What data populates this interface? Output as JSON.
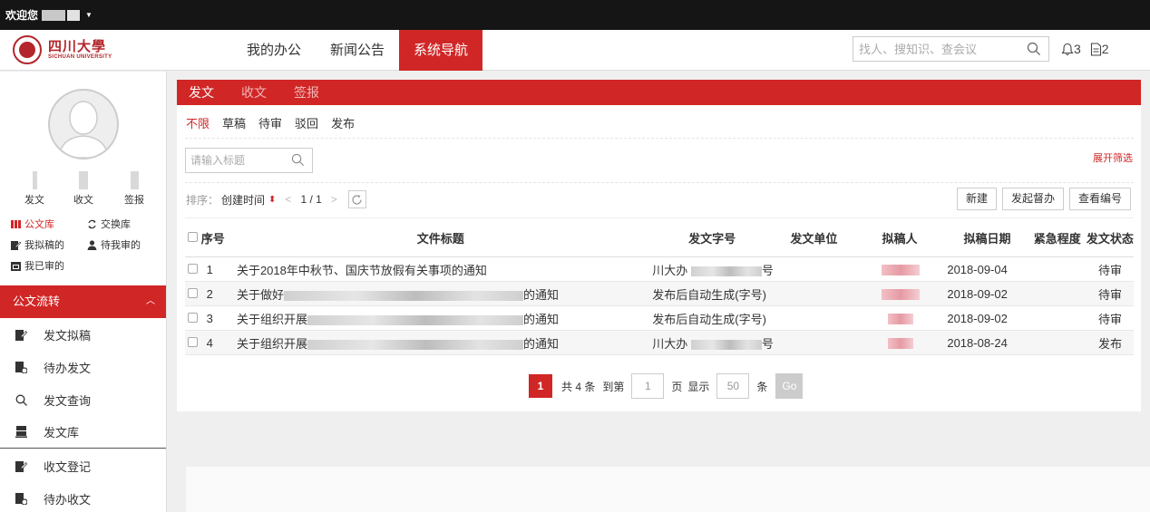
{
  "topbar": {
    "welcome": "欢迎您",
    "caret": "▼"
  },
  "header": {
    "logo_cn": "四川大學",
    "logo_en": "SICHUAN UNIVERSITY",
    "nav": [
      {
        "label": "我的办公",
        "active": false
      },
      {
        "label": "新闻公告",
        "active": false
      },
      {
        "label": "系统导航",
        "active": true
      }
    ],
    "search_placeholder": "找人、搜知识、查会议",
    "bell_count": "3",
    "doc_count": "2"
  },
  "sidebar": {
    "stats": [
      "发文",
      "收文",
      "签报"
    ],
    "quick": [
      "公文库",
      "交换库",
      "我拟稿的",
      "待我审的",
      "我已审的"
    ],
    "menu_head": "公文流转",
    "menu": [
      "发文拟稿",
      "待办发文",
      "发文查询",
      "发文库",
      "收文登记",
      "待办收文"
    ]
  },
  "panel": {
    "tabs": [
      {
        "label": "发文",
        "active": true
      },
      {
        "label": "收文",
        "active": false
      },
      {
        "label": "签报",
        "active": false
      }
    ],
    "filters": [
      {
        "label": "不限",
        "active": true
      },
      {
        "label": "草稿",
        "active": false
      },
      {
        "label": "待审",
        "active": false
      },
      {
        "label": "驳回",
        "active": false
      },
      {
        "label": "发布",
        "active": false
      }
    ],
    "title_placeholder": "请输入标题",
    "expand": "展开筛选",
    "sort_label": "排序：",
    "sort_value": "创建时间",
    "page_info": "1 / 1",
    "actions": [
      "新建",
      "发起督办",
      "查看编号"
    ],
    "columns": {
      "no": "序号",
      "title": "文件标题",
      "code": "发文字号",
      "unit": "发文单位",
      "author": "拟稿人",
      "date": "拟稿日期",
      "urgency": "紧急程度",
      "status": "发文状态"
    },
    "rows": [
      {
        "no": "1",
        "title": "关于2018年中秋节、国庆节放假有关事项的通知",
        "title_pre": "",
        "title_post": "",
        "code_pre": "川大办",
        "code_post": "号",
        "code_full": "",
        "date": "2018-09-04",
        "status": "待审"
      },
      {
        "no": "2",
        "title": "",
        "title_pre": "关于做好",
        "title_post": "的通知",
        "code_pre": "",
        "code_post": "",
        "code_full": "发布后自动生成(字号)",
        "date": "2018-09-02",
        "status": "待审"
      },
      {
        "no": "3",
        "title": "",
        "title_pre": "关于组织开展",
        "title_post": "的通知",
        "code_pre": "",
        "code_post": "",
        "code_full": "发布后自动生成(字号)",
        "date": "2018-09-02",
        "status": "待审"
      },
      {
        "no": "4",
        "title": "",
        "title_pre": "关于组织开展",
        "title_post": "的通知",
        "code_pre": "川大办",
        "code_post": "号",
        "code_full": "",
        "date": "2018-08-24",
        "status": "发布"
      }
    ],
    "pager": {
      "current": "1",
      "total_text": "共 4 条",
      "goto": "到第",
      "goto_val": "1",
      "page": "页",
      "show": "显示",
      "show_val": "50",
      "unit": "条",
      "go": "Go"
    }
  },
  "colors": {
    "accent": "#d12626"
  }
}
